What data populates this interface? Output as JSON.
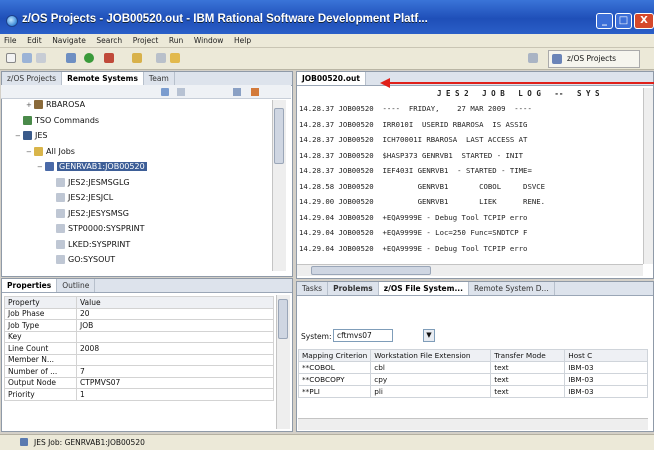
{
  "window": {
    "title": "z/OS Projects - JOB00520.out - IBM Rational Software Development Platf...",
    "min": "_",
    "max": "□",
    "close": "X"
  },
  "menu": [
    "File",
    "Edit",
    "Navigate",
    "Search",
    "Project",
    "Run",
    "Window",
    "Help"
  ],
  "toolbar": {
    "perspective": "z/OS Projects"
  },
  "left_tabs": {
    "projects": "z/OS Projects",
    "remote": "Remote Systems",
    "team": "Team"
  },
  "tree": [
    {
      "label": "RBAROSA",
      "icon": "system-icon",
      "indent": 2,
      "twisty": "+"
    },
    {
      "label": "TSO Commands",
      "icon": "tso-icon",
      "indent": 1,
      "twisty": ""
    },
    {
      "label": "JES",
      "icon": "jes-icon",
      "indent": 1,
      "twisty": "−"
    },
    {
      "label": "All Jobs",
      "icon": "folder-icon",
      "indent": 2,
      "twisty": "−"
    },
    {
      "label": "GENRVAB1:JOB00520",
      "icon": "job-icon",
      "indent": 3,
      "twisty": "−",
      "selected": true
    },
    {
      "label": "JES2:JESMSGLG",
      "icon": "file-icon",
      "indent": 4,
      "twisty": ""
    },
    {
      "label": "JES2:JESJCL",
      "icon": "file-icon",
      "indent": 4,
      "twisty": ""
    },
    {
      "label": "JES2:JESYSMSG",
      "icon": "file-icon",
      "indent": 4,
      "twisty": ""
    },
    {
      "label": "STP0000:SYSPRINT",
      "icon": "file-icon",
      "indent": 4,
      "twisty": ""
    },
    {
      "label": "LKED:SYSPRINT",
      "icon": "file-icon",
      "indent": 4,
      "twisty": ""
    },
    {
      "label": "GO:SYSOUT",
      "icon": "file-icon",
      "indent": 4,
      "twisty": ""
    }
  ],
  "props_tabs": {
    "properties": "Properties",
    "outline": "Outline"
  },
  "props": {
    "headers": [
      "Property",
      "Value"
    ],
    "rows": [
      [
        "Job Phase",
        "20"
      ],
      [
        "Job Type",
        "JOB"
      ],
      [
        "Key",
        ""
      ],
      [
        "Line Count",
        "2008"
      ],
      [
        "Member N...",
        ""
      ],
      [
        "Number of ...",
        "7"
      ],
      [
        "Output Node",
        "CTPMVS07"
      ],
      [
        "Priority",
        "1"
      ]
    ]
  },
  "editor": {
    "tab": "JOB00520.out",
    "header": "J E S 2   J O B   L O G   --   S Y S",
    "lines": [
      "14.28.37 JOB00520  ----  FRIDAY,    27 MAR 2009  ----",
      "14.28.37 JOB00520  IRR010I  USERID RBAROSA  IS ASSIG",
      "14.28.37 JOB00520  ICH70001I RBAROSA  LAST ACCESS AT",
      "14.28.37 JOB00520  $HASP373 GENRVB1  STARTED - INIT",
      "14.28.37 JOB00520  IEF403I GENRVB1  - STARTED - TIME=",
      "14.28.58 JOB00520          GENRVB1       COBOL     DSVCE",
      "14.29.00 JOB00520          GENRVB1       LIEK      RENE.",
      "14.29.04 JOB00520  +EQA9999E - Debug Tool TCPIP erro",
      "14.29.04 JOB00520  +EQA9999E - Loc=250 Func=SNDTCP F",
      "14.29.04 JOB00520  +EQA9999E - Debug Tool TCPIP erro"
    ]
  },
  "bottom_tabs": [
    "Tasks",
    "Problems",
    "z/OS File System...",
    "Remote System D..."
  ],
  "system": {
    "label": "System:",
    "value": "cftmvs07"
  },
  "mapping": {
    "headers": [
      "Mapping Criterion",
      "Workstation File Extension",
      "Transfer Mode",
      "Host C"
    ],
    "rows": [
      [
        "**COBOL",
        "cbl",
        "text",
        "IBM-03"
      ],
      [
        "**COBCOPY",
        "cpy",
        "text",
        "IBM-03"
      ],
      [
        "**PLI",
        "pli",
        "text",
        "IBM-03"
      ]
    ]
  },
  "status": {
    "text": "JES Job: GENRVAB1:JOB00520"
  }
}
